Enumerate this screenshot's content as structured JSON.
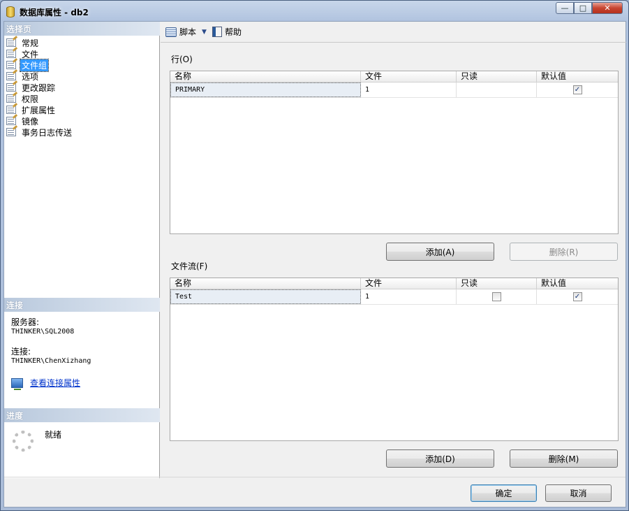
{
  "window": {
    "title": "数据库属性 - db2",
    "minimize": "—",
    "maximize": "□",
    "close": "✕"
  },
  "left": {
    "select_page_header": "选择页",
    "pages": [
      {
        "label": "常规",
        "selected": false
      },
      {
        "label": "文件",
        "selected": false
      },
      {
        "label": "文件组",
        "selected": true
      },
      {
        "label": "选项",
        "selected": false
      },
      {
        "label": "更改跟踪",
        "selected": false
      },
      {
        "label": "权限",
        "selected": false
      },
      {
        "label": "扩展属性",
        "selected": false
      },
      {
        "label": "镜像",
        "selected": false
      },
      {
        "label": "事务日志传送",
        "selected": false
      }
    ],
    "connection_header": "连接",
    "server_label": "服务器:",
    "server_value": "THINKER\\SQL2008",
    "connection_label": "连接:",
    "connection_value": "THINKER\\ChenXizhang",
    "view_conn_props": "查看连接属性",
    "progress_header": "进度",
    "status": "就绪"
  },
  "toolbar": {
    "script_label": "脚本",
    "help_label": "帮助"
  },
  "rows_section": {
    "label": "行(O)",
    "columns": [
      "名称",
      "文件",
      "只读",
      "默认值"
    ],
    "rows": [
      {
        "name": "PRIMARY",
        "files": "1",
        "readonly": null,
        "default": true
      }
    ],
    "add_button": "添加(A)",
    "remove_button": "删除(R)"
  },
  "filestream_section": {
    "label": "文件流(F)",
    "columns": [
      "名称",
      "文件",
      "只读",
      "默认值"
    ],
    "rows": [
      {
        "name": "Test",
        "files": "1",
        "readonly": false,
        "default": true
      }
    ],
    "add_button": "添加(D)",
    "remove_button": "删除(M)"
  },
  "footer": {
    "ok_button": "确定",
    "cancel_button": "取消"
  }
}
